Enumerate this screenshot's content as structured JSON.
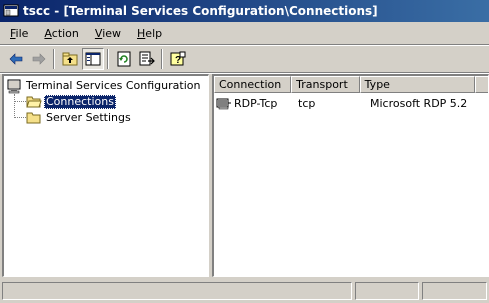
{
  "window": {
    "title": "tscc - [Terminal Services Configuration\\Connections]"
  },
  "menu": {
    "items": [
      {
        "first": "F",
        "rest": "ile"
      },
      {
        "first": "A",
        "rest": "ction"
      },
      {
        "first": "V",
        "rest": "iew"
      },
      {
        "first": "H",
        "rest": "elp"
      }
    ]
  },
  "toolbar": {
    "icons": [
      "back-arrow-icon",
      "forward-arrow-icon",
      "up-folder-icon",
      "show-hide-tree-icon",
      "refresh-icon",
      "export-list-icon",
      "help-icon"
    ]
  },
  "tree": {
    "root_label": "Terminal Services Configuration",
    "items": [
      {
        "label": "Connections",
        "selected": true
      },
      {
        "label": "Server Settings",
        "selected": false
      }
    ]
  },
  "list": {
    "columns": [
      "Connection",
      "Transport",
      "Type"
    ],
    "rows": [
      {
        "connection": "RDP-Tcp",
        "transport": "tcp",
        "type": "Microsoft RDP 5.2"
      }
    ]
  },
  "colors": {
    "title_gradient_start": "#0a246a",
    "title_gradient_end": "#3a6ea5",
    "selection": "#0a246a",
    "face": "#d4d0c8"
  }
}
